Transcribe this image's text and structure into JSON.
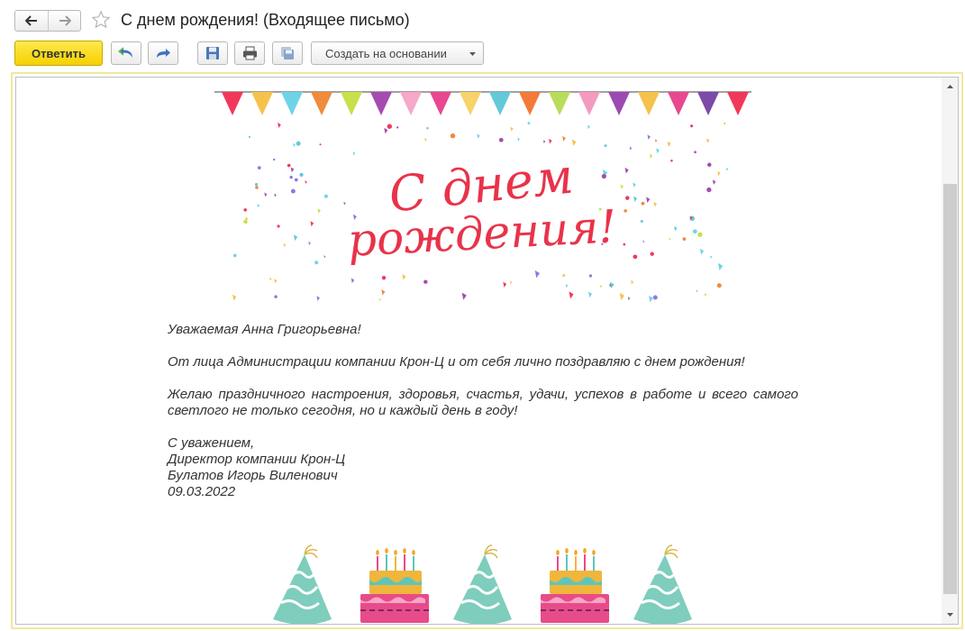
{
  "window": {
    "title": "С днем рождения! (Входящее письмо)"
  },
  "toolbar": {
    "reply_label": "Ответить",
    "create_based_on_label": "Создать на основании"
  },
  "email": {
    "greeting_line1": "С днем",
    "greeting_line2": "рождения!",
    "salutation": "Уважаемая Анна Григорьевна!",
    "paragraph1": "От лица Администрации компании Крон-Ц и от себя лично поздравляю с днем рождения!",
    "paragraph2": "Желаю праздничного настроения, здоровья, счастья, удачи, успехов в работе и всего самого светлого не только сегодня, но и каждый день в году!",
    "signature": {
      "closing": "С уважением,",
      "position": "Директор компании Крон-Ц",
      "name": "Булатов Игорь Виленович",
      "date": "09.03.2022"
    }
  },
  "colors": {
    "accent_yellow": "#f5d100",
    "frame_border": "#f2e89b",
    "greeting_red": "#e8334a",
    "icon_blue": "#3b73c4"
  },
  "icons": {
    "back": "arrow-left-icon",
    "forward": "arrow-right-icon",
    "favorite": "star-icon",
    "undo": "undo-arrow-icon",
    "redo": "redo-arrow-icon",
    "save": "floppy-disk-icon",
    "print": "printer-icon",
    "save_copy": "save-copy-icon"
  }
}
